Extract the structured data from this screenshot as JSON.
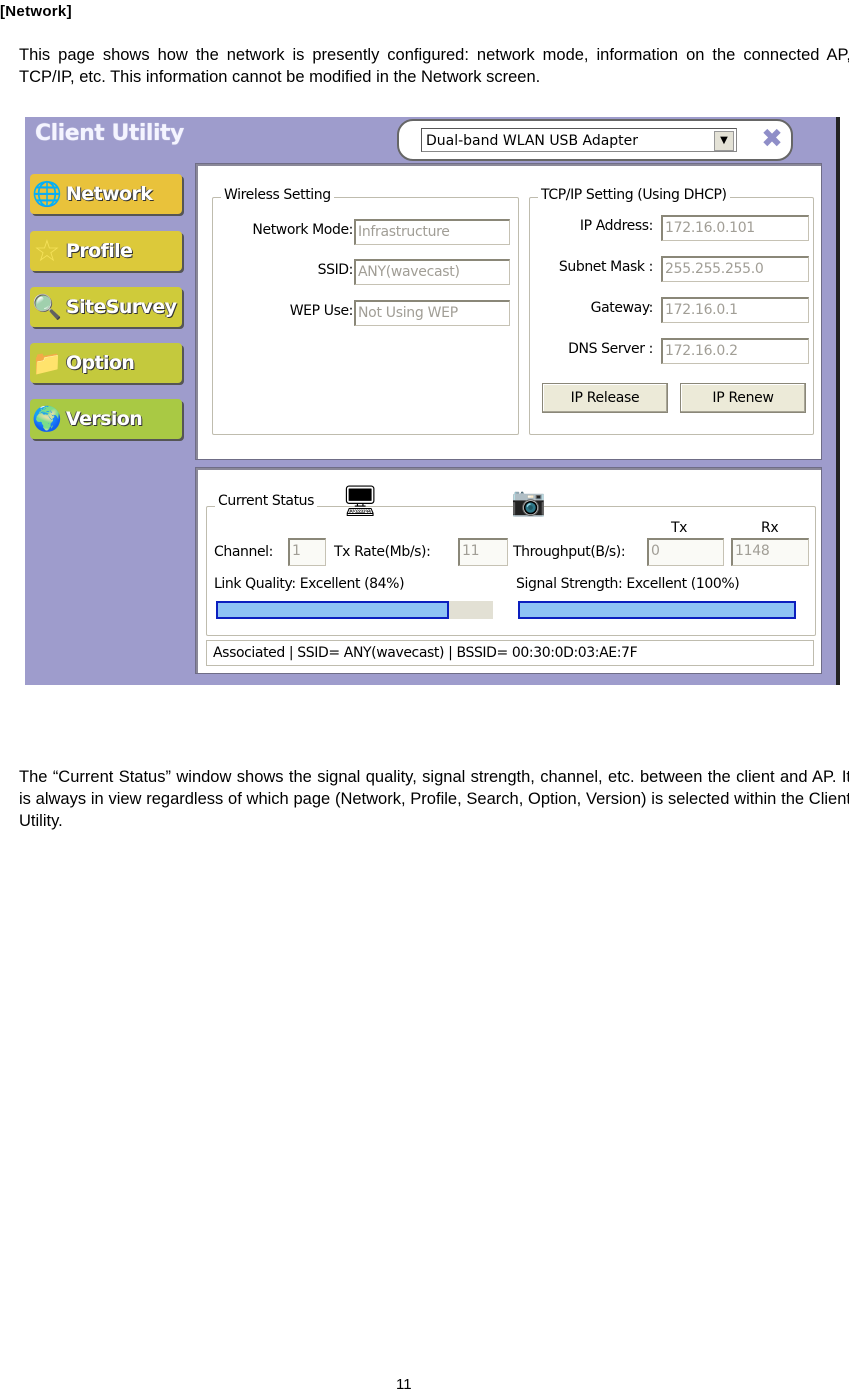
{
  "document": {
    "heading": "[Network]",
    "intro": "This page shows how the network is presently configured: network mode, information on the connected AP, TCP/IP, etc. This information cannot be modified in the Network screen.",
    "description": "The “Current Status” window shows the signal quality, signal strength, channel, etc. between the client and AP. It is always in view regardless of which page (Network, Profile, Search, Option, Version) is selected within the Client Utility.",
    "page_number": "11"
  },
  "app": {
    "title": "Client Utility",
    "adapter": {
      "selected": "Dual-band WLAN USB Adapter",
      "dropdown_glyph": "▼",
      "close_glyph": "✖"
    },
    "nav": [
      {
        "label": "Network",
        "icon": "globe-network-icon",
        "glyph": "🌐"
      },
      {
        "label": "Profile",
        "icon": "star-icon",
        "glyph": "☆"
      },
      {
        "label": "SiteSurvey",
        "icon": "magnifier-icon",
        "glyph": "🔍"
      },
      {
        "label": "Option",
        "icon": "folder-options-icon",
        "glyph": "📁"
      },
      {
        "label": "Version",
        "icon": "globe-stand-icon",
        "glyph": "🌍"
      }
    ],
    "wireless": {
      "title": "Wireless Setting",
      "fields": [
        {
          "label": "Network Mode:",
          "value": "Infrastructure"
        },
        {
          "label": "SSID:",
          "value": "ANY(wavecast)"
        },
        {
          "label": "WEP Use:",
          "value": "Not Using WEP"
        }
      ]
    },
    "tcpip": {
      "title": "TCP/IP Setting  (Using DHCP)",
      "fields": [
        {
          "label": "IP Address:",
          "value": "172.16.0.101"
        },
        {
          "label": "Subnet Mask :",
          "value": "255.255.255.0"
        },
        {
          "label": "Gateway:",
          "value": "172.16.0.1"
        },
        {
          "label": "DNS Server :",
          "value": "172.16.0.2"
        }
      ],
      "release_label": "IP Release",
      "renew_label": "IP Renew"
    },
    "status": {
      "title": "Current Status",
      "channel_label": "Channel:",
      "channel": "1",
      "txrate_label": "Tx Rate(Mb/s):",
      "txrate": "11",
      "throughput_label": "Throughput(B/s):",
      "tx_header": "Tx",
      "rx_header": "Rx",
      "tx": "0",
      "rx": "1148",
      "link_quality_label": "Link Quality:  Excellent (84%)",
      "link_quality_percent": 84,
      "signal_strength_label": "Signal Strength:  Excellent (100%)",
      "signal_strength_percent": 100,
      "statusbar": "Associated | SSID= ANY(wavecast) | BSSID= 00:30:0D:03:AE:7F"
    }
  }
}
